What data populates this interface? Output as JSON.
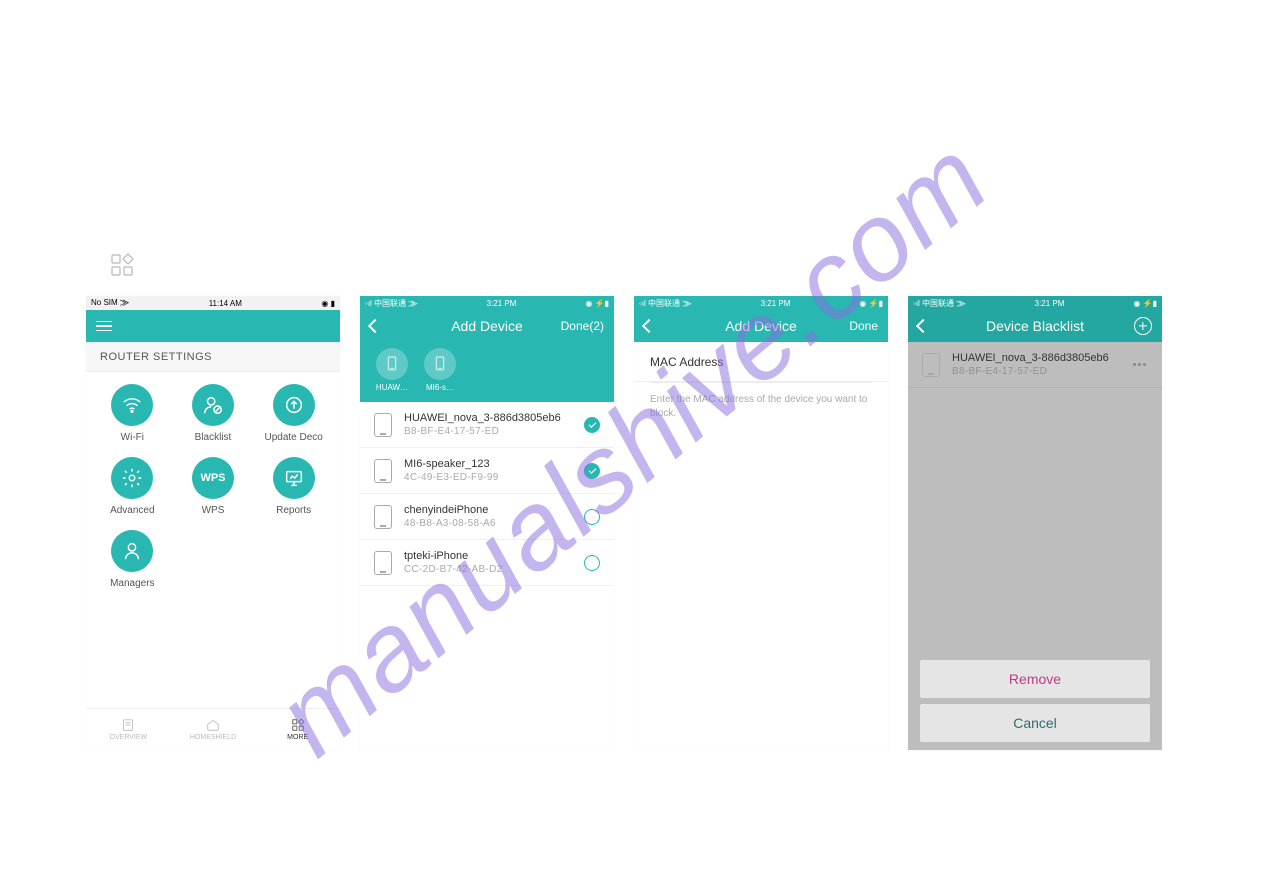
{
  "watermark": "manualshive.com",
  "phone1": {
    "status": {
      "left": "No SIM ⨠",
      "center": "11:14 AM",
      "right": "◉ ▮"
    },
    "section_title": "ROUTER SETTINGS",
    "items": [
      {
        "label": "Wi-Fi",
        "icon_key": "wifi"
      },
      {
        "label": "Blacklist",
        "icon_key": "blacklist"
      },
      {
        "label": "Update Deco",
        "icon_key": "update"
      },
      {
        "label": "Advanced",
        "icon_key": "advanced"
      },
      {
        "label": "WPS",
        "icon_key": "wps"
      },
      {
        "label": "Reports",
        "icon_key": "reports"
      },
      {
        "label": "Managers",
        "icon_key": "managers"
      }
    ],
    "tabs": [
      {
        "label": "OVERVIEW",
        "icon": "overview"
      },
      {
        "label": "HOMESHIELD",
        "icon": "homeshield"
      },
      {
        "label": "MORE",
        "icon": "more"
      }
    ]
  },
  "phone2": {
    "status": {
      "left": "◦ıl 中国联通 ⨠",
      "center": "3:21 PM",
      "right": "◉ ⚡▮"
    },
    "title": "Add Device",
    "done_label": "Done(2)",
    "chips": [
      {
        "label": "HUAW…"
      },
      {
        "label": "MI6-s…"
      }
    ],
    "devices": [
      {
        "name": "HUAWEI_nova_3-886d3805eb6",
        "mac": "B8-BF-E4-17-57-ED",
        "checked": true
      },
      {
        "name": "MI6-speaker_123",
        "mac": "4C-49-E3-ED-F9-99",
        "checked": true
      },
      {
        "name": "chenyindeiPhone",
        "mac": "48-B8-A3-08-58-A6",
        "checked": false
      },
      {
        "name": "tpteki-iPhone",
        "mac": "CC-2D-B7-42-AB-D2",
        "checked": false
      }
    ]
  },
  "phone3": {
    "status": {
      "left": "◦ıl 中国联通 ⨠",
      "center": "3:21 PM",
      "right": "◉ ⚡▮"
    },
    "title": "Add Device",
    "done_label": "Done",
    "mac_label": "MAC Address",
    "hint": "Enter the MAC address of the device you want to block."
  },
  "phone4": {
    "status": {
      "left": "◦ıl 中国联通 ⨠",
      "center": "3:21 PM",
      "right": "◉ ⚡▮"
    },
    "title": "Device Blacklist",
    "device": {
      "name": "HUAWEI_nova_3-886d3805eb6",
      "mac": "B8-BF-E4-17-57-ED"
    },
    "actions": {
      "remove": "Remove",
      "cancel": "Cancel"
    }
  }
}
